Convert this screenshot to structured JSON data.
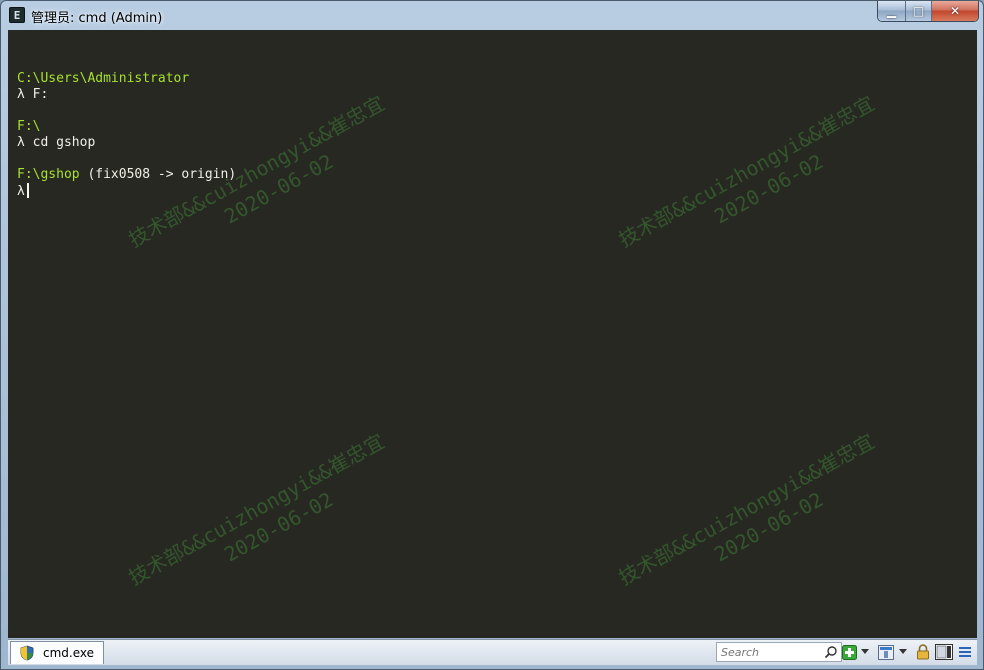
{
  "window": {
    "title": "管理员: cmd (Admin)",
    "icon_glyph": "E",
    "buttons": [
      "minimize-icon",
      "maximize-icon",
      "close-icon"
    ],
    "minimize_glyph": "▁",
    "maximize_glyph": "□",
    "close_glyph": "✕"
  },
  "console": {
    "prompt_symbol": "λ",
    "blocks": [
      {
        "path": "C:\\Users\\Administrator",
        "branch": "",
        "command": "F:"
      },
      {
        "path": "F:\\",
        "branch": "",
        "command": "cd gshop"
      },
      {
        "path": "F:\\gshop",
        "branch": " (fix0508 -> origin)",
        "command": ""
      }
    ],
    "colors": {
      "background": "#272822",
      "path": "#a6e22e",
      "text": "#f0efe7"
    }
  },
  "watermark": {
    "text": "技术部&&cuizhongyi&&崔忠宜",
    "date": "2020-06-02"
  },
  "statusbar": {
    "tab_label": "cmd.exe",
    "search_placeholder": "Search",
    "icons": [
      "search-icon",
      "new-tab-icon",
      "dropdown-icon",
      "view-icon",
      "dropdown-icon",
      "lock-icon",
      "panels-icon",
      "menu-icon"
    ]
  }
}
